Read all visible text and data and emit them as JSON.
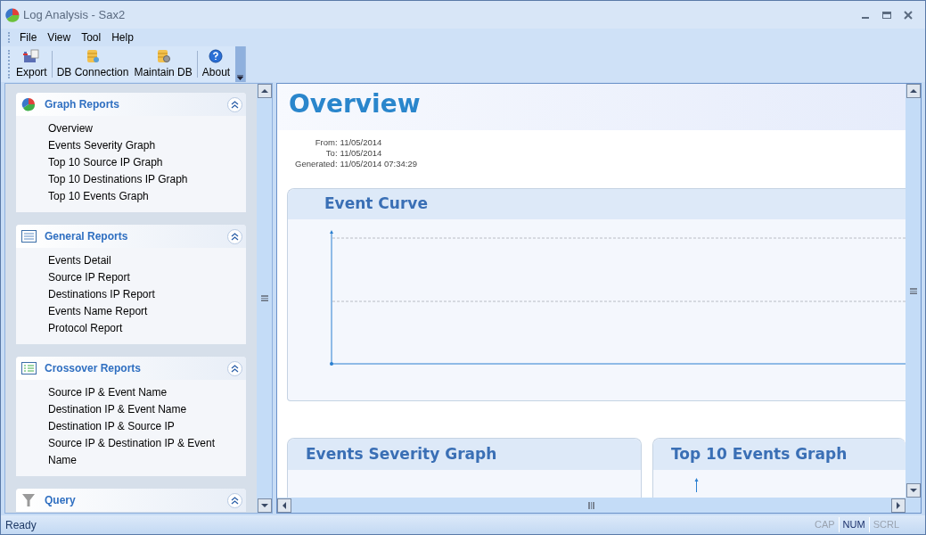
{
  "window": {
    "title": "Log Analysis - Sax2"
  },
  "menu": [
    "File",
    "View",
    "Tool",
    "Help"
  ],
  "toolbar": [
    {
      "label": "Export",
      "kind": "export"
    },
    {
      "label": "DB Connection",
      "kind": "db"
    },
    {
      "label": "Maintain DB",
      "kind": "maintain"
    },
    {
      "label": "About",
      "kind": "about"
    }
  ],
  "sidebar": {
    "groups": [
      {
        "title": "Graph Reports",
        "kind": "pie",
        "expanded": true,
        "items": [
          "Overview",
          "Events Severity Graph",
          "Top 10 Source IP Graph",
          "Top 10 Destinations IP Graph",
          "Top 10 Events Graph"
        ]
      },
      {
        "title": "General Reports",
        "kind": "list",
        "expanded": true,
        "items": [
          "Events Detail",
          "Source IP Report",
          "Destinations IP Report",
          "Events Name Report",
          "Protocol Report"
        ]
      },
      {
        "title": "Crossover Reports",
        "kind": "table",
        "expanded": true,
        "items": [
          "Source IP & Event Name",
          "Destination IP & Event Name",
          "Destination IP & Source IP",
          "Source IP & Destination IP & Event Name"
        ]
      },
      {
        "title": "Query",
        "kind": "filter",
        "expanded": true
      }
    ]
  },
  "report": {
    "title": "Overview",
    "meta": [
      {
        "label": "From:",
        "value": "11/05/2014"
      },
      {
        "label": "To:",
        "value": "11/05/2014"
      },
      {
        "label": "Generated:",
        "value": "11/05/2014 07:34:29"
      }
    ],
    "main_section": {
      "title": "Event Curve"
    },
    "sections": [
      {
        "title": "Events Severity Graph"
      },
      {
        "title": "Top 10 Events Graph"
      }
    ]
  },
  "status_bar": {
    "text": "Ready",
    "indicators": [
      {
        "label": "CAP",
        "on": false
      },
      {
        "label": "NUM",
        "on": true
      },
      {
        "label": "SCRL",
        "on": false
      }
    ]
  }
}
